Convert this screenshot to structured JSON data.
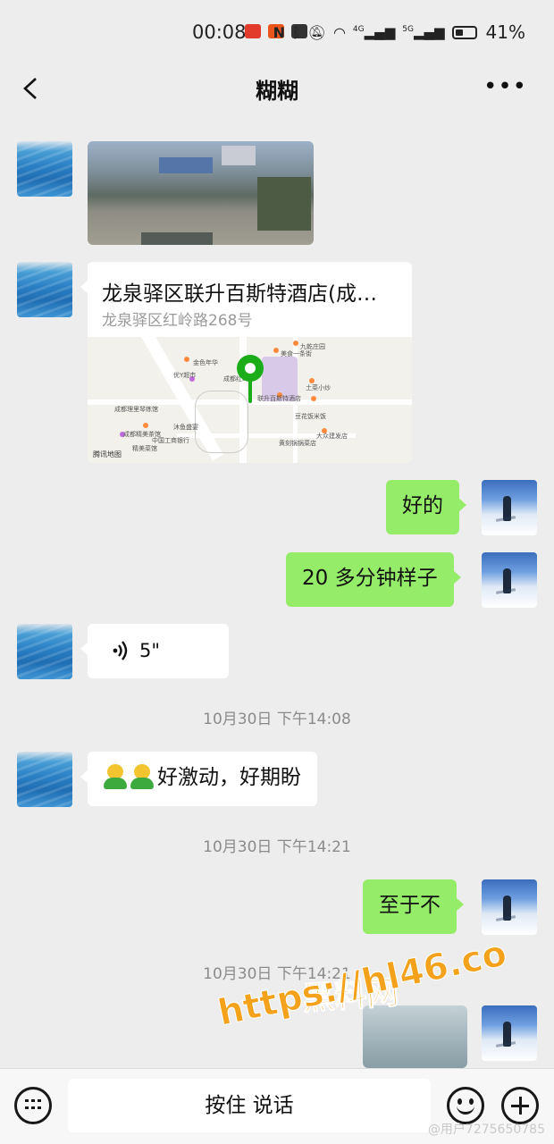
{
  "status_bar": {
    "time": "00:08",
    "signal_labels": [
      "4G",
      "5G"
    ],
    "battery_percent": "41%",
    "battery_level": 0.41
  },
  "nav": {
    "title": "糊糊"
  },
  "messages": [
    {
      "type": "image",
      "side": "left"
    },
    {
      "type": "location",
      "side": "left",
      "title": "龙泉驿区联升百斯特酒店(成…",
      "address": "龙泉驿区红岭路268号",
      "map_brand": "腾讯地图"
    },
    {
      "type": "text",
      "side": "right",
      "text": "好的"
    },
    {
      "type": "text",
      "side": "right",
      "text": "20 多分钟样子"
    },
    {
      "type": "voice",
      "side": "left",
      "duration": "5\""
    },
    {
      "type": "timestamp",
      "text": "10月30日 下午14:08"
    },
    {
      "type": "text",
      "side": "left",
      "text": "好激动，好期盼"
    },
    {
      "type": "timestamp",
      "text": "10月30日 下午14:21"
    },
    {
      "type": "text",
      "side": "right",
      "text": "至于不"
    },
    {
      "type": "timestamp",
      "text": "10月30日 下午14:21"
    },
    {
      "type": "image",
      "side": "right"
    }
  ],
  "map_labels": [
    "九乾庄园",
    "美食一条街",
    "联升百斯特酒店",
    "土菜小炒",
    "豆花饭米饭",
    "大众建发店",
    "黄刻锅锅菜店",
    "成都理里琴练馆",
    "成都精美茶馆",
    "中国工商银行",
    "精美菜馆",
    "沐鱼盛宴",
    "优Y超市",
    "金色年华",
    "成都红岭"
  ],
  "watermark": {
    "line1": "黑料网",
    "line2": "https://hl46.co"
  },
  "input_bar": {
    "talk_label": "按住 说话"
  },
  "footer_mark": "@用户7275650785",
  "colors": {
    "background": "#ededed",
    "green_bubble": "#95ec69",
    "white_bubble": "#ffffff",
    "pin": "#1aad19",
    "watermark": "#f4a21c"
  }
}
